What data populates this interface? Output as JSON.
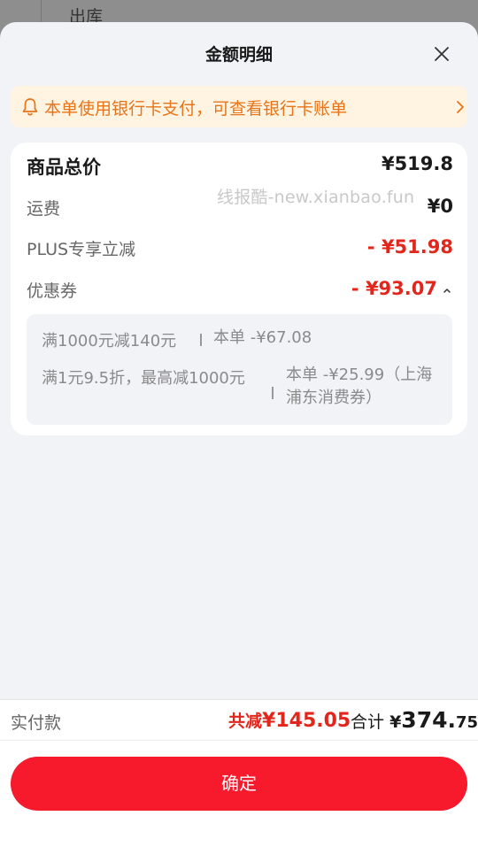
{
  "background": {
    "partial_text": "出库"
  },
  "sheet": {
    "title": "金额明细",
    "notice": {
      "text": "本单使用银行卡支付，可查看银行卡账单"
    },
    "summary": {
      "total_label": "商品总价",
      "total_value": "¥519.8",
      "shipping_label": "运费",
      "shipping_value": "¥0",
      "plus_label": "PLUS专享立减",
      "plus_value": "- ¥51.98",
      "coupon_label": "优惠券",
      "coupon_value": "- ¥93.07",
      "watermark": "线报酷-new.xianbao.fun",
      "coupons": [
        {
          "name": "满1000元减140元",
          "amount": "本单 -¥67.08"
        },
        {
          "name": "满1元9.5折，最高减1000元",
          "amount": "本单 -¥25.99（上海浦东消费券）"
        }
      ]
    }
  },
  "footer": {
    "pay_label": "实付款",
    "reduce_prefix": "共减",
    "reduce_amount": "¥145.05",
    "total_prefix": "合计",
    "total_currency": "¥",
    "total_integer": "374.",
    "total_decimal": "75",
    "confirm_label": "确定"
  },
  "colors": {
    "accent": "#e3261b",
    "button": "#f7192c",
    "notice_bg": "#fff4e1",
    "notice_text": "#e8741a"
  },
  "icons": {
    "close": "close-icon",
    "bell": "bell-icon",
    "chevron": "chevron-right-icon",
    "caret": "caret-up-icon"
  }
}
